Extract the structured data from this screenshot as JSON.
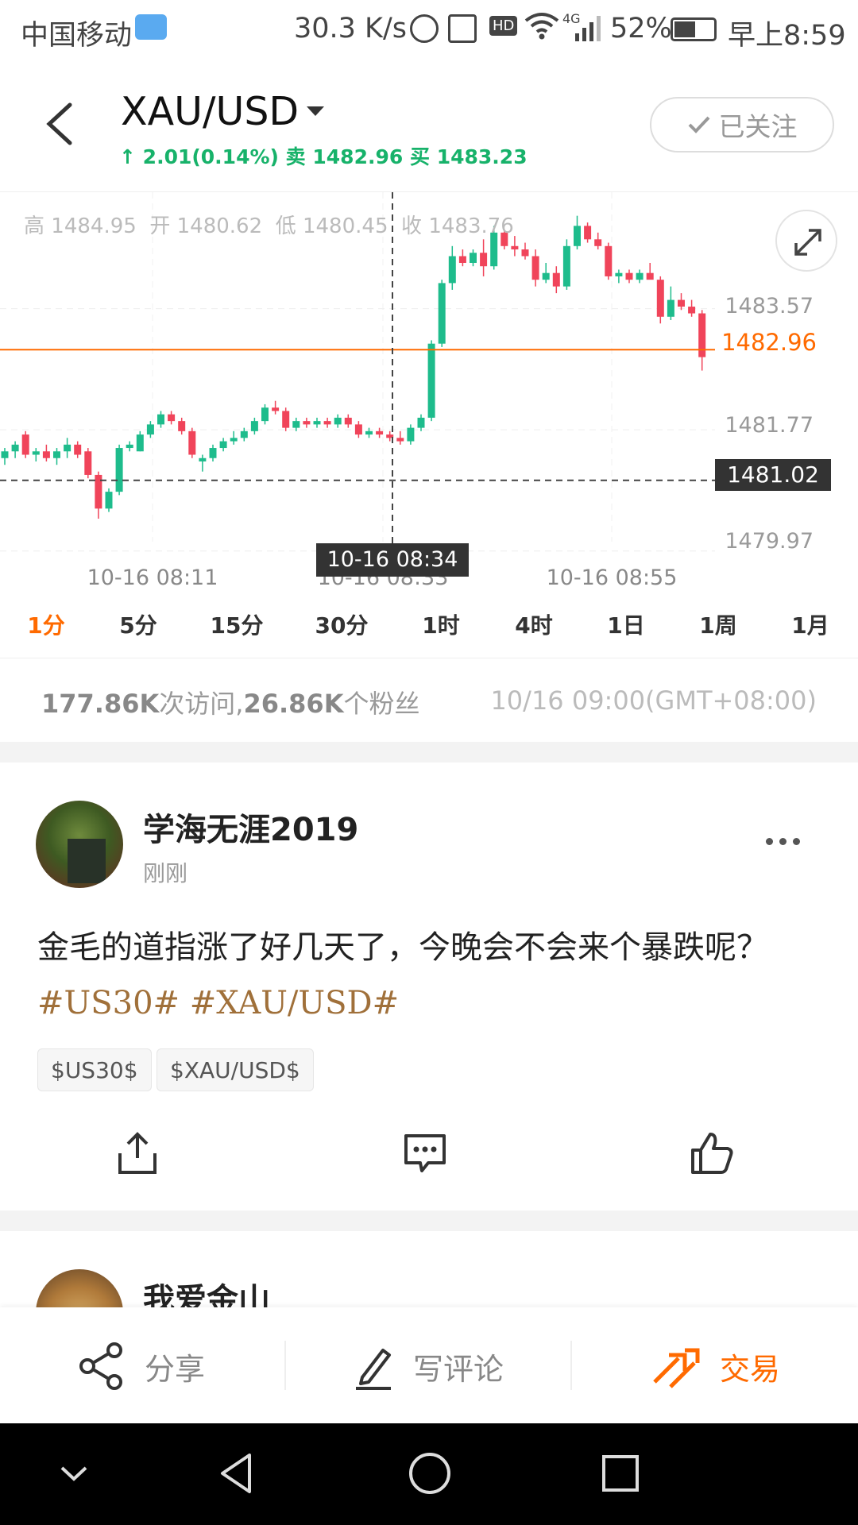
{
  "status_bar": {
    "carrier": "中国移动",
    "net_speed": "30.3 K/s",
    "hd": "HD",
    "signal": "4G",
    "battery": "52%",
    "time": "早上8:59"
  },
  "header": {
    "symbol": "XAU/USD",
    "change": "2.01(0.14%)",
    "sell_label": "卖",
    "sell": "1482.96",
    "buy_label": "买",
    "buy": "1483.23",
    "follow_label": "已关注"
  },
  "chart": {
    "ohlc": {
      "high_label": "高",
      "high": "1484.95",
      "open_label": "开",
      "open": "1480.62",
      "low_label": "低",
      "low": "1480.45",
      "close_label": "收",
      "close": "1483.76"
    },
    "y_ticks": [
      "1483.57",
      "1481.77",
      "1479.97"
    ],
    "last_price": "1482.96",
    "cross_price": "1481.02",
    "x_ticks": [
      "10-16 08:11",
      "10-16 08:33",
      "10-16 08:55"
    ],
    "cross_time": "10-16 08:34",
    "colors": {
      "up": "#1ebc8c",
      "down": "#f0445a",
      "last": "#ff6a00"
    }
  },
  "chart_data": {
    "type": "candlestick",
    "xlabel": "",
    "ylabel": "",
    "ylim": [
      1479.4,
      1485.3
    ],
    "candles": [
      [
        1481.35,
        1481.5,
        1481.25,
        1481.45
      ],
      [
        1481.45,
        1481.6,
        1481.35,
        1481.55
      ],
      [
        1481.7,
        1481.75,
        1481.35,
        1481.4
      ],
      [
        1481.4,
        1481.5,
        1481.3,
        1481.45
      ],
      [
        1481.45,
        1481.55,
        1481.3,
        1481.35
      ],
      [
        1481.35,
        1481.5,
        1481.25,
        1481.45
      ],
      [
        1481.45,
        1481.65,
        1481.35,
        1481.55
      ],
      [
        1481.55,
        1481.6,
        1481.35,
        1481.4
      ],
      [
        1481.45,
        1481.5,
        1481.05,
        1481.1
      ],
      [
        1481.1,
        1481.15,
        1480.45,
        1480.6
      ],
      [
        1480.6,
        1480.9,
        1480.55,
        1480.85
      ],
      [
        1480.85,
        1481.55,
        1480.8,
        1481.5
      ],
      [
        1481.5,
        1481.6,
        1481.45,
        1481.55
      ],
      [
        1481.45,
        1481.75,
        1481.45,
        1481.7
      ],
      [
        1481.7,
        1481.9,
        1481.65,
        1481.85
      ],
      [
        1481.85,
        1482.05,
        1481.8,
        1482.0
      ],
      [
        1482.0,
        1482.05,
        1481.85,
        1481.9
      ],
      [
        1481.9,
        1481.95,
        1481.7,
        1481.75
      ],
      [
        1481.75,
        1481.8,
        1481.35,
        1481.4
      ],
      [
        1481.3,
        1481.4,
        1481.15,
        1481.35
      ],
      [
        1481.35,
        1481.55,
        1481.3,
        1481.5
      ],
      [
        1481.5,
        1481.65,
        1481.45,
        1481.6
      ],
      [
        1481.6,
        1481.75,
        1481.55,
        1481.65
      ],
      [
        1481.65,
        1481.8,
        1481.6,
        1481.75
      ],
      [
        1481.75,
        1481.95,
        1481.7,
        1481.9
      ],
      [
        1481.9,
        1482.15,
        1481.85,
        1482.1
      ],
      [
        1482.1,
        1482.2,
        1482.0,
        1482.05
      ],
      [
        1482.05,
        1482.1,
        1481.75,
        1481.8
      ],
      [
        1481.8,
        1481.95,
        1481.75,
        1481.9
      ],
      [
        1481.9,
        1481.95,
        1481.8,
        1481.85
      ],
      [
        1481.85,
        1481.95,
        1481.8,
        1481.9
      ],
      [
        1481.9,
        1481.95,
        1481.8,
        1481.85
      ],
      [
        1481.85,
        1482.0,
        1481.8,
        1481.95
      ],
      [
        1481.95,
        1482.0,
        1481.8,
        1481.85
      ],
      [
        1481.85,
        1481.9,
        1481.65,
        1481.7
      ],
      [
        1481.7,
        1481.8,
        1481.65,
        1481.75
      ],
      [
        1481.75,
        1481.8,
        1481.65,
        1481.7
      ],
      [
        1481.7,
        1481.75,
        1481.6,
        1481.65
      ],
      [
        1481.65,
        1481.75,
        1481.55,
        1481.6
      ],
      [
        1481.6,
        1481.85,
        1481.55,
        1481.8
      ],
      [
        1481.8,
        1482.0,
        1481.75,
        1481.95
      ],
      [
        1481.95,
        1483.1,
        1481.9,
        1483.05
      ],
      [
        1483.05,
        1484.0,
        1483.0,
        1483.95
      ],
      [
        1483.95,
        1484.5,
        1483.85,
        1484.35
      ],
      [
        1484.35,
        1484.45,
        1484.2,
        1484.25
      ],
      [
        1484.25,
        1484.45,
        1484.2,
        1484.4
      ],
      [
        1484.4,
        1484.6,
        1484.05,
        1484.2
      ],
      [
        1484.2,
        1484.8,
        1484.15,
        1484.7
      ],
      [
        1484.7,
        1484.75,
        1484.45,
        1484.5
      ],
      [
        1484.5,
        1484.65,
        1484.35,
        1484.45
      ],
      [
        1484.45,
        1484.55,
        1484.3,
        1484.35
      ],
      [
        1484.35,
        1484.45,
        1483.9,
        1484.0
      ],
      [
        1484.0,
        1484.25,
        1483.95,
        1484.1
      ],
      [
        1484.1,
        1484.2,
        1483.8,
        1483.9
      ],
      [
        1483.9,
        1484.6,
        1483.85,
        1484.5
      ],
      [
        1484.5,
        1484.95,
        1484.45,
        1484.8
      ],
      [
        1484.8,
        1484.85,
        1484.55,
        1484.6
      ],
      [
        1484.6,
        1484.7,
        1484.45,
        1484.5
      ],
      [
        1484.5,
        1484.55,
        1484.0,
        1484.05
      ],
      [
        1484.05,
        1484.15,
        1483.95,
        1484.1
      ],
      [
        1484.1,
        1484.15,
        1483.95,
        1484.0
      ],
      [
        1484.0,
        1484.15,
        1483.95,
        1484.1
      ],
      [
        1484.1,
        1484.25,
        1484.05,
        1484.0
      ],
      [
        1484.0,
        1484.05,
        1483.35,
        1483.45
      ],
      [
        1483.45,
        1483.9,
        1483.4,
        1483.7
      ],
      [
        1483.7,
        1483.8,
        1483.55,
        1483.6
      ],
      [
        1483.6,
        1483.7,
        1483.45,
        1483.5
      ],
      [
        1483.5,
        1483.55,
        1482.65,
        1482.85
      ]
    ]
  },
  "periods": [
    "1分",
    "5分",
    "15分",
    "30分",
    "1时",
    "4时",
    "1日",
    "1周",
    "1月"
  ],
  "active_period": "1分",
  "stats": {
    "visits": "177.86K",
    "visits_label": "次访问,",
    "fans": "26.86K",
    "fans_label": "个粉丝",
    "date": "10/16 09:00(GMT+08:00)"
  },
  "post": {
    "author": "学海无涯2019",
    "time": "刚刚",
    "text": "金毛的道指涨了好几天了，今晚会不会来个暴跌呢？",
    "tags": [
      "#US30#",
      "#XAU/USD#"
    ],
    "chips": [
      "$US30$",
      "$XAU/USD$"
    ]
  },
  "next_post": {
    "author": "我爱金山"
  },
  "bottom_bar": {
    "share": "分享",
    "comment": "写评论",
    "trade": "交易"
  }
}
